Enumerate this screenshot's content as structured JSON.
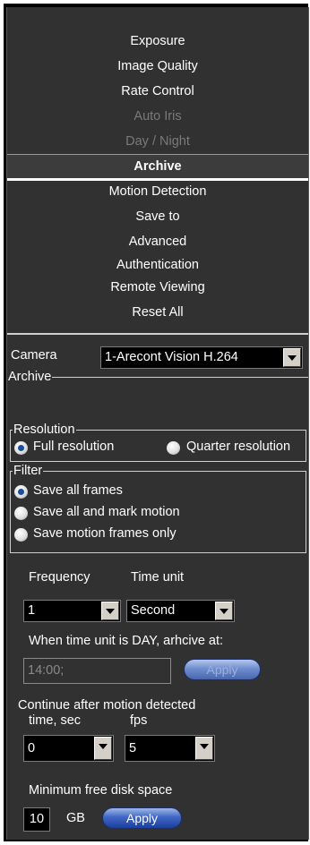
{
  "menu": {
    "items": [
      {
        "label": "Exposure"
      },
      {
        "label": "Image Quality"
      },
      {
        "label": "Rate Control"
      },
      {
        "label": "Auto Iris"
      },
      {
        "label": "Day / Night"
      },
      {
        "label": "Archive"
      },
      {
        "label": "Motion Detection"
      },
      {
        "label": "Save to"
      },
      {
        "label": "Advanced"
      },
      {
        "label": "Authentication"
      },
      {
        "label": "Remote Viewing"
      },
      {
        "label": "Reset All"
      }
    ],
    "disabled": [
      "Auto Iris",
      "Day / Night"
    ],
    "active": "Archive"
  },
  "camera": {
    "label": "Camera",
    "value": "1-Arecont Vision H.264"
  },
  "archive_group": {
    "label": "Archive"
  },
  "resolution": {
    "legend": "Resolution",
    "full": "Full resolution",
    "quarter": "Quarter resolution",
    "selected": "Full resolution"
  },
  "filter": {
    "legend": "Filter",
    "opt1": "Save all frames",
    "opt2": "Save all and mark motion",
    "opt3": "Save motion frames only",
    "selected": "Save all frames"
  },
  "frequency": {
    "label": "Frequency",
    "value": "1"
  },
  "time_unit": {
    "label": "Time unit",
    "value": "Second"
  },
  "day_archive": {
    "label": "When time unit is DAY, arhcive at:",
    "value": "14:00;",
    "button": "Apply"
  },
  "continue": {
    "label": "Continue after motion detected",
    "time_label": "time, sec",
    "time_value": "0",
    "fps_label": "fps",
    "fps_value": "5"
  },
  "disk": {
    "label": "Minimum free disk space",
    "value": "10",
    "unit": "GB",
    "button": "Apply"
  },
  "colors": {
    "panel": "#313131",
    "frame": "#000000",
    "button": "#3f66c4",
    "radio_dot": "#1e4e9a"
  }
}
